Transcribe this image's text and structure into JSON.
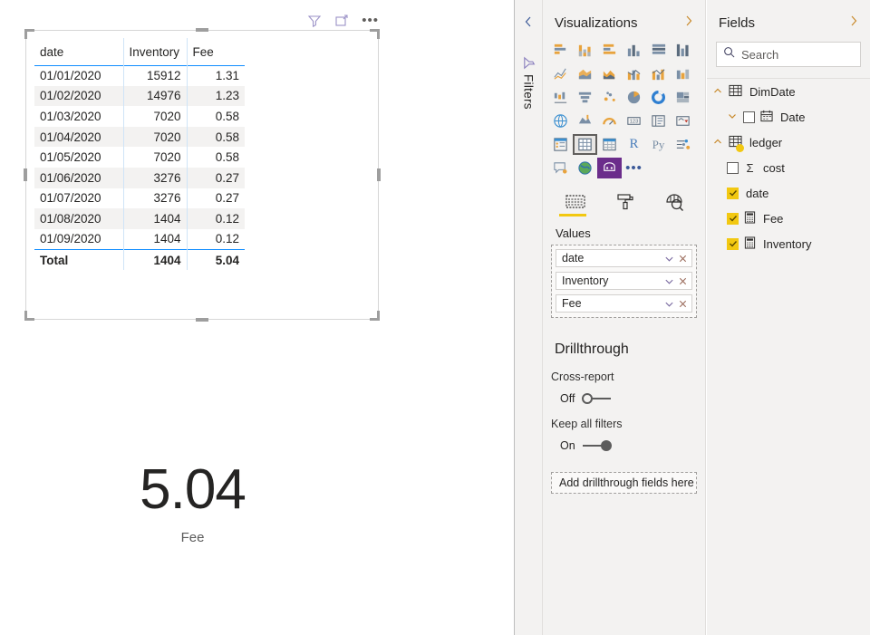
{
  "visual_header": {
    "filter_icon": "filter-funnel-icon",
    "focus_icon": "focus-mode-icon",
    "more_label": "•••"
  },
  "table_visual": {
    "columns": [
      "date",
      "Inventory",
      "Fee"
    ],
    "rows": [
      {
        "date": "01/01/2020",
        "inventory": "15912",
        "fee": "1.31"
      },
      {
        "date": "01/02/2020",
        "inventory": "14976",
        "fee": "1.23"
      },
      {
        "date": "01/03/2020",
        "inventory": "7020",
        "fee": "0.58"
      },
      {
        "date": "01/04/2020",
        "inventory": "7020",
        "fee": "0.58"
      },
      {
        "date": "01/05/2020",
        "inventory": "7020",
        "fee": "0.58"
      },
      {
        "date": "01/06/2020",
        "inventory": "3276",
        "fee": "0.27"
      },
      {
        "date": "01/07/2020",
        "inventory": "3276",
        "fee": "0.27"
      },
      {
        "date": "01/08/2020",
        "inventory": "1404",
        "fee": "0.12"
      },
      {
        "date": "01/09/2020",
        "inventory": "1404",
        "fee": "0.12"
      }
    ],
    "total": {
      "label": "Total",
      "inventory": "1404",
      "fee": "5.04"
    },
    "header_underline_color": "#118dff",
    "alt_row_color": "#f3f2f1"
  },
  "card_visual": {
    "value": "5.04",
    "label": "Fee"
  },
  "filters_pane": {
    "title": "Filters",
    "collapse_icon": "chevron-left-icon",
    "funnel_icon": "filter-funnel-icon"
  },
  "visualizations": {
    "title": "Visualizations",
    "expand_icon": "chevron-right-icon",
    "icons": [
      "stacked-bar-chart-icon",
      "stacked-column-chart-icon",
      "clustered-bar-chart-icon",
      "clustered-column-chart-icon",
      "hundred-percent-stacked-bar-icon",
      "hundred-percent-stacked-column-icon",
      "line-chart-icon",
      "area-chart-icon",
      "stacked-area-chart-icon",
      "line-stacked-column-icon",
      "line-clustered-column-icon",
      "ribbon-chart-icon",
      "waterfall-chart-icon",
      "funnel-chart-icon",
      "scatter-chart-icon",
      "pie-chart-icon",
      "donut-chart-icon",
      "treemap-icon",
      "map-icon",
      "filled-map-icon",
      "gauge-icon",
      "card-icon",
      "multi-row-card-icon",
      "kpi-icon",
      "slicer-icon",
      "table-icon",
      "matrix-icon",
      "r-script-visual-icon",
      "python-visual-icon",
      "key-influencers-icon",
      "smart-narrative-icon",
      "arcgis-map-icon",
      "paginated-report-icon",
      "more-visuals-icon"
    ],
    "selected_icon": "table-icon",
    "purple_icon": "paginated-report-icon",
    "more_label": "•••",
    "well_tabs": [
      {
        "name": "fields-tab",
        "icon": "fields-icon",
        "active": true
      },
      {
        "name": "format-tab",
        "icon": "paint-roller-icon",
        "active": false
      },
      {
        "name": "analytics-tab",
        "icon": "analytics-magnifier-icon",
        "active": false
      }
    ],
    "values_heading": "Values",
    "values_fields": [
      "date",
      "Inventory",
      "Fee"
    ],
    "field_chevron_icon": "chevron-down-icon",
    "field_remove_icon": "close-x-icon"
  },
  "drillthrough": {
    "title": "Drillthrough",
    "cross_report": {
      "label": "Cross-report",
      "state": "Off",
      "on": false
    },
    "keep_all_filters": {
      "label": "Keep all filters",
      "state": "On",
      "on": true
    },
    "drop_zone": "Add drillthrough fields here"
  },
  "fields": {
    "title": "Fields",
    "expand_icon": "chevron-right-icon",
    "search": {
      "placeholder": "Search",
      "value": "",
      "icon": "search-icon"
    },
    "tables": [
      {
        "name": "DimDate",
        "icon": "table-icon",
        "expanded": true,
        "items": [
          {
            "label": "Date",
            "checked": false,
            "icon": "calendar-icon",
            "expandable": true
          }
        ]
      },
      {
        "name": "ledger",
        "icon": "table-checked-icon",
        "expanded": true,
        "items": [
          {
            "label": "cost",
            "checked": false,
            "icon": "sigma-icon",
            "expandable": false
          },
          {
            "label": "date",
            "checked": true,
            "icon": "none",
            "expandable": false
          },
          {
            "label": "Fee",
            "checked": true,
            "icon": "calculator-icon",
            "expandable": false
          },
          {
            "label": "Inventory",
            "checked": true,
            "icon": "calculator-icon",
            "expandable": false
          }
        ]
      }
    ]
  },
  "colors": {
    "accent_blue": "#118dff",
    "accent_yellow": "#f2c811",
    "pane_bg": "#f3f2f1",
    "purple": "#6b2d8b"
  }
}
